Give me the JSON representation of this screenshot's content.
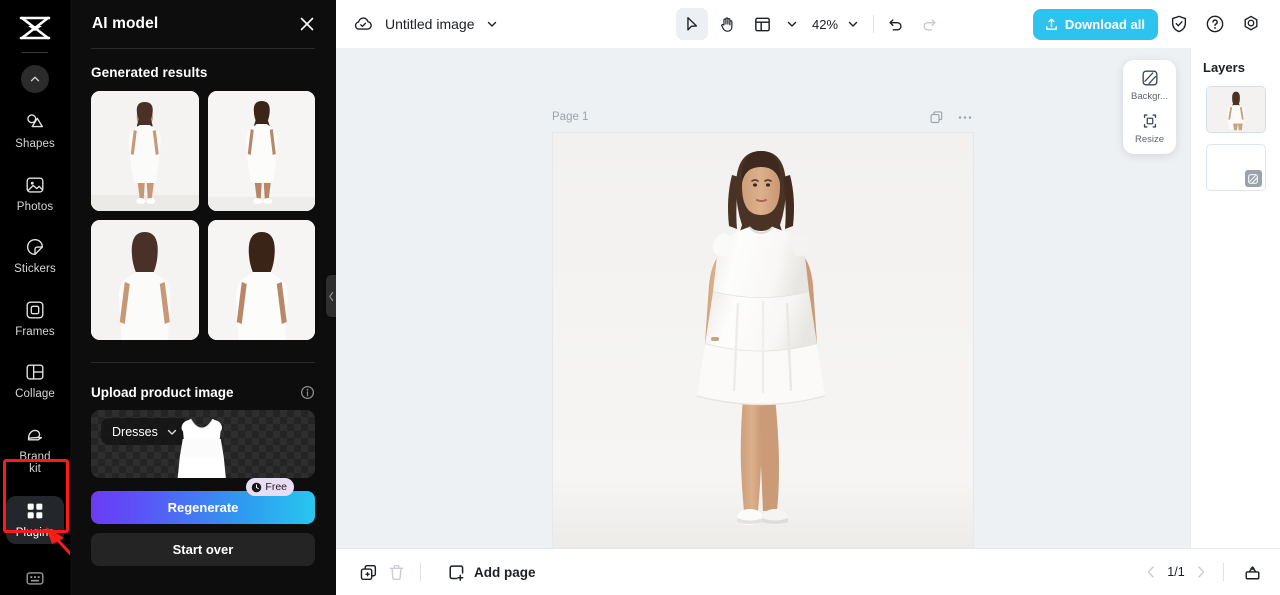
{
  "app": {
    "logo_icon": "capcut-logo-icon"
  },
  "rail": {
    "collapse_icon": "chevron-up-icon",
    "items": [
      {
        "label": "Shapes",
        "icon": "shapes-icon"
      },
      {
        "label": "Photos",
        "icon": "photos-icon"
      },
      {
        "label": "Stickers",
        "icon": "stickers-icon"
      },
      {
        "label": "Frames",
        "icon": "frames-icon"
      },
      {
        "label": "Collage",
        "icon": "collage-icon"
      },
      {
        "label": "Brand\nkit",
        "label_line1": "Brand",
        "label_line2": "kit",
        "icon": "brand-kit-icon"
      },
      {
        "label": "Plugins",
        "icon": "plugins-grid-icon",
        "active": true
      }
    ],
    "bottom_icon": "keyboard-icon",
    "highlight_color": "#ff1a1a",
    "arrow_color": "#ff1a1a"
  },
  "panel": {
    "title": "AI model",
    "close_icon": "close-icon",
    "generated": {
      "title": "Generated results",
      "thumbs": [
        {
          "name": "generated-result-1"
        },
        {
          "name": "generated-result-2"
        },
        {
          "name": "generated-result-3"
        },
        {
          "name": "generated-result-4"
        }
      ]
    },
    "upload": {
      "title": "Upload product image",
      "info_icon": "info-icon",
      "category_value": "Dresses",
      "category_chevron": "chevron-down-icon",
      "product_image_alt": "white-dress-cutout"
    },
    "regenerate": {
      "label": "Regenerate",
      "badge_label": "Free",
      "badge_icon": "clock-icon",
      "gradient_from": "#6a3cf5",
      "gradient_to": "#27c6ef"
    },
    "start_over": {
      "label": "Start over"
    },
    "collapse_handle_icon": "chevron-left-icon"
  },
  "topbar": {
    "cloud_icon": "cloud-saved-icon",
    "doc_title": "Untitled image",
    "title_chevron": "chevron-down-icon",
    "tools": [
      {
        "name": "select-tool",
        "icon": "cursor-icon",
        "selected": true
      },
      {
        "name": "hand-tool",
        "icon": "hand-icon",
        "selected": false
      },
      {
        "name": "layout-tool",
        "icon": "layout-icon",
        "selected": false
      }
    ],
    "layout_chevron": "chevron-down-icon",
    "zoom_value": "42%",
    "zoom_chevron": "chevron-down-icon",
    "undo_icon": "undo-icon",
    "redo_icon": "redo-icon",
    "download": {
      "label": "Download all",
      "icon": "download-icon",
      "color": "#2ec2ef"
    },
    "right_icons": [
      {
        "name": "shield-check-icon"
      },
      {
        "name": "help-circle-icon"
      },
      {
        "name": "settings-gear-icon"
      }
    ]
  },
  "canvas": {
    "page_label": "Page 1",
    "page_actions": [
      {
        "name": "duplicate-page-icon"
      },
      {
        "name": "more-options-icon"
      }
    ],
    "artboard_alt": "ai-model-wearing-white-dress",
    "background_color": "#eef1f4"
  },
  "float_tools": [
    {
      "label": "Backgr...",
      "icon": "background-icon",
      "name": "background-tool"
    },
    {
      "label": "Resize",
      "icon": "resize-icon",
      "name": "resize-tool"
    }
  ],
  "layers": {
    "title": "Layers",
    "items": [
      {
        "name": "layer-image",
        "type": "image",
        "selected": true
      },
      {
        "name": "layer-background",
        "type": "background",
        "badge_icon": "background-icon"
      }
    ]
  },
  "bottombar": {
    "duplicate_icon": "duplicate-page-icon",
    "delete_icon": "trash-icon",
    "add_page": {
      "label": "Add page",
      "icon": "add-page-icon"
    },
    "prev_icon": "chevron-left-icon",
    "page_count": "1/1",
    "next_icon": "chevron-right-icon",
    "present_icon": "present-icon"
  }
}
